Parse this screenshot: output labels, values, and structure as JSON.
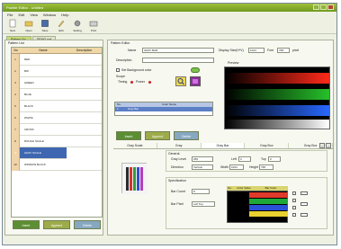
{
  "window": {
    "title": "Palette Editor - Untitled"
  },
  "menu": [
    "File",
    "Edit",
    "View",
    "Window",
    "Help"
  ],
  "toolbar": [
    {
      "label": "New",
      "icon": "new-file-icon"
    },
    {
      "label": "Open",
      "icon": "open-folder-icon"
    },
    {
      "label": "Save",
      "icon": "save-icon"
    },
    {
      "label": "Edit",
      "icon": "pencil-icon"
    },
    {
      "label": "Setting",
      "icon": "settings-icon"
    },
    {
      "label": "Print",
      "icon": "print-icon"
    }
  ],
  "doc_tabs": [
    "Pattern No.",
    "DEMO.pat"
  ],
  "palette_list": {
    "title": "Pattern List",
    "headers": [
      "No",
      "Name",
      "Description"
    ],
    "rows": [
      {
        "no": "1",
        "name": "RED"
      },
      {
        "no": "2",
        "name": "BW"
      },
      {
        "no": "3",
        "name": "GREEN"
      },
      {
        "no": "4",
        "name": "BLUE"
      },
      {
        "no": "5",
        "name": "BLACK"
      },
      {
        "no": "6",
        "name": "WHITE"
      },
      {
        "no": "7",
        "name": "CROSS"
      },
      {
        "no": "8",
        "name": "ROUGH SCALE"
      },
      {
        "no": "9",
        "name": "GRAY SCALE"
      },
      {
        "no": "10",
        "name": "WINDOW BLACK"
      }
    ],
    "selected_index": 8,
    "buttons": {
      "insert": "Insert",
      "append": "Append",
      "delete": "Delete"
    }
  },
  "editor": {
    "title": "Pattern Editor",
    "name_label": "Name",
    "name_value": "GRAY BAR",
    "description_label": "Description",
    "display_size_label": "Display Size(H*V)",
    "display_w": "1024",
    "display_h": "768",
    "pixel_label": "pixel",
    "fore_label": "Fore",
    "set_background_label": "Set Background color",
    "scope_label": "Scope",
    "timing_label": "Timing",
    "power_label": "Power",
    "preview_label": "Preview",
    "color_headers": [
      "No.",
      "Color Name"
    ],
    "color_row": [
      "1",
      "Gray Bar"
    ],
    "buttons": {
      "insert": "Insert",
      "append": "Append",
      "delete": "Delete"
    }
  },
  "subtabs": [
    "Gray Scale",
    "Gray",
    "Gray Bar",
    "Gray Box",
    "Gray Box"
  ],
  "general": {
    "label": "General",
    "gray_level_label": "Gray Level",
    "gray_level_value": "256",
    "left_label": "Left",
    "left_value": "0",
    "top_label": "Top",
    "top_value": "0",
    "direction_label": "Direction",
    "direction_value": "Vertical",
    "width_label": "Width",
    "width_value": "1024",
    "height_label": "Height",
    "height_value": "768"
  },
  "specification": {
    "label": "Specification",
    "bar_count_label": "Bar Count",
    "bar_count_value": "8",
    "bar_pixel_label": "Bar Pixel",
    "bar_pixel_value": "Left Top",
    "table_headers": [
      "No.",
      "Color Value",
      "Bar Color"
    ]
  },
  "colors": {
    "accent": "#8fb33a",
    "selection": "#3f67b1",
    "insert": "#5c8f34",
    "append": "#9dab4a",
    "delete": "#86a8c0"
  }
}
